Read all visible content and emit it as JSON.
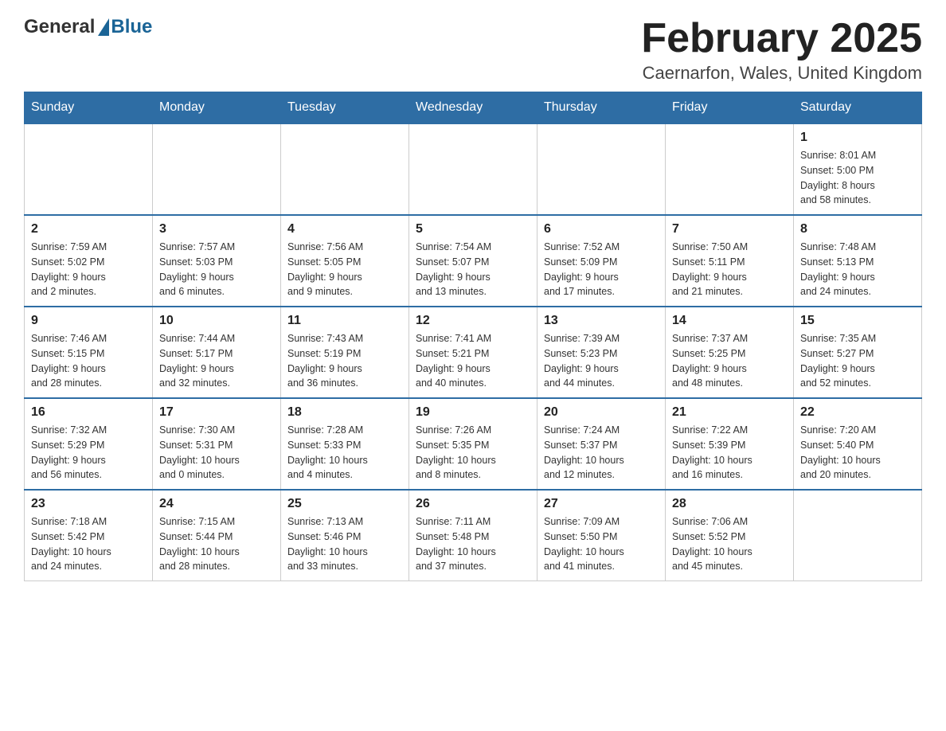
{
  "header": {
    "logo_general": "General",
    "logo_blue": "Blue",
    "title": "February 2025",
    "location": "Caernarfon, Wales, United Kingdom"
  },
  "weekdays": [
    "Sunday",
    "Monday",
    "Tuesday",
    "Wednesday",
    "Thursday",
    "Friday",
    "Saturday"
  ],
  "weeks": [
    [
      {
        "day": "",
        "info": ""
      },
      {
        "day": "",
        "info": ""
      },
      {
        "day": "",
        "info": ""
      },
      {
        "day": "",
        "info": ""
      },
      {
        "day": "",
        "info": ""
      },
      {
        "day": "",
        "info": ""
      },
      {
        "day": "1",
        "info": "Sunrise: 8:01 AM\nSunset: 5:00 PM\nDaylight: 8 hours\nand 58 minutes."
      }
    ],
    [
      {
        "day": "2",
        "info": "Sunrise: 7:59 AM\nSunset: 5:02 PM\nDaylight: 9 hours\nand 2 minutes."
      },
      {
        "day": "3",
        "info": "Sunrise: 7:57 AM\nSunset: 5:03 PM\nDaylight: 9 hours\nand 6 minutes."
      },
      {
        "day": "4",
        "info": "Sunrise: 7:56 AM\nSunset: 5:05 PM\nDaylight: 9 hours\nand 9 minutes."
      },
      {
        "day": "5",
        "info": "Sunrise: 7:54 AM\nSunset: 5:07 PM\nDaylight: 9 hours\nand 13 minutes."
      },
      {
        "day": "6",
        "info": "Sunrise: 7:52 AM\nSunset: 5:09 PM\nDaylight: 9 hours\nand 17 minutes."
      },
      {
        "day": "7",
        "info": "Sunrise: 7:50 AM\nSunset: 5:11 PM\nDaylight: 9 hours\nand 21 minutes."
      },
      {
        "day": "8",
        "info": "Sunrise: 7:48 AM\nSunset: 5:13 PM\nDaylight: 9 hours\nand 24 minutes."
      }
    ],
    [
      {
        "day": "9",
        "info": "Sunrise: 7:46 AM\nSunset: 5:15 PM\nDaylight: 9 hours\nand 28 minutes."
      },
      {
        "day": "10",
        "info": "Sunrise: 7:44 AM\nSunset: 5:17 PM\nDaylight: 9 hours\nand 32 minutes."
      },
      {
        "day": "11",
        "info": "Sunrise: 7:43 AM\nSunset: 5:19 PM\nDaylight: 9 hours\nand 36 minutes."
      },
      {
        "day": "12",
        "info": "Sunrise: 7:41 AM\nSunset: 5:21 PM\nDaylight: 9 hours\nand 40 minutes."
      },
      {
        "day": "13",
        "info": "Sunrise: 7:39 AM\nSunset: 5:23 PM\nDaylight: 9 hours\nand 44 minutes."
      },
      {
        "day": "14",
        "info": "Sunrise: 7:37 AM\nSunset: 5:25 PM\nDaylight: 9 hours\nand 48 minutes."
      },
      {
        "day": "15",
        "info": "Sunrise: 7:35 AM\nSunset: 5:27 PM\nDaylight: 9 hours\nand 52 minutes."
      }
    ],
    [
      {
        "day": "16",
        "info": "Sunrise: 7:32 AM\nSunset: 5:29 PM\nDaylight: 9 hours\nand 56 minutes."
      },
      {
        "day": "17",
        "info": "Sunrise: 7:30 AM\nSunset: 5:31 PM\nDaylight: 10 hours\nand 0 minutes."
      },
      {
        "day": "18",
        "info": "Sunrise: 7:28 AM\nSunset: 5:33 PM\nDaylight: 10 hours\nand 4 minutes."
      },
      {
        "day": "19",
        "info": "Sunrise: 7:26 AM\nSunset: 5:35 PM\nDaylight: 10 hours\nand 8 minutes."
      },
      {
        "day": "20",
        "info": "Sunrise: 7:24 AM\nSunset: 5:37 PM\nDaylight: 10 hours\nand 12 minutes."
      },
      {
        "day": "21",
        "info": "Sunrise: 7:22 AM\nSunset: 5:39 PM\nDaylight: 10 hours\nand 16 minutes."
      },
      {
        "day": "22",
        "info": "Sunrise: 7:20 AM\nSunset: 5:40 PM\nDaylight: 10 hours\nand 20 minutes."
      }
    ],
    [
      {
        "day": "23",
        "info": "Sunrise: 7:18 AM\nSunset: 5:42 PM\nDaylight: 10 hours\nand 24 minutes."
      },
      {
        "day": "24",
        "info": "Sunrise: 7:15 AM\nSunset: 5:44 PM\nDaylight: 10 hours\nand 28 minutes."
      },
      {
        "day": "25",
        "info": "Sunrise: 7:13 AM\nSunset: 5:46 PM\nDaylight: 10 hours\nand 33 minutes."
      },
      {
        "day": "26",
        "info": "Sunrise: 7:11 AM\nSunset: 5:48 PM\nDaylight: 10 hours\nand 37 minutes."
      },
      {
        "day": "27",
        "info": "Sunrise: 7:09 AM\nSunset: 5:50 PM\nDaylight: 10 hours\nand 41 minutes."
      },
      {
        "day": "28",
        "info": "Sunrise: 7:06 AM\nSunset: 5:52 PM\nDaylight: 10 hours\nand 45 minutes."
      },
      {
        "day": "",
        "info": ""
      }
    ]
  ]
}
